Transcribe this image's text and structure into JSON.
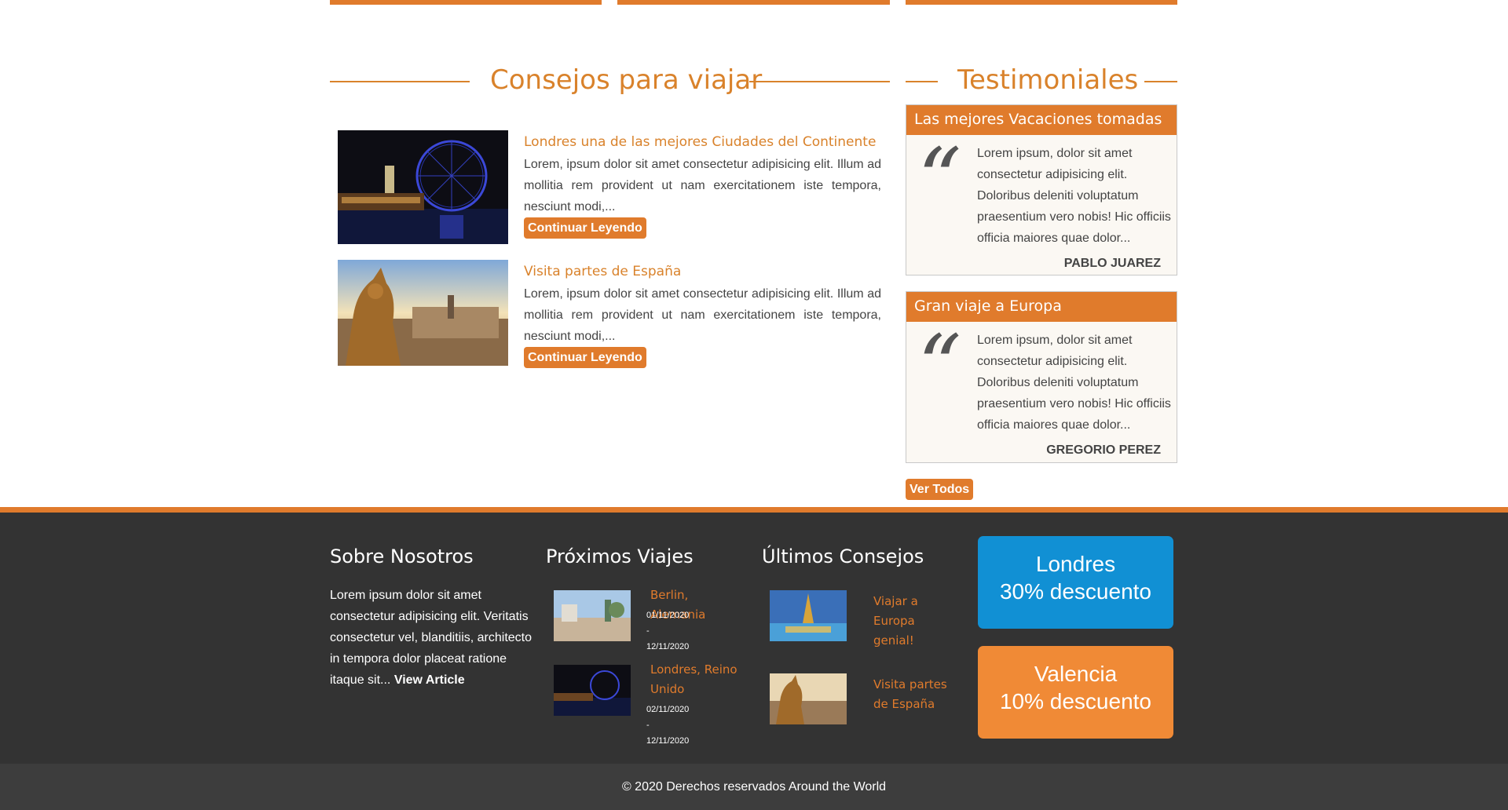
{
  "colors": {
    "accent": "#e07b2c",
    "title": "#d9822b",
    "footer_bg": "#333333",
    "promo_blue": "#1190d4",
    "promo_orange": "#f08a36"
  },
  "sections": {
    "tips_title": "Consejos para viajar",
    "testimonials_title": "Testimoniales"
  },
  "articles": [
    {
      "title": "Londres una de las mejores Ciudades del Continente",
      "text": "Lorem, ipsum dolor sit amet consectetur adipisicing elit. Illum ad mollitia rem provident ut nam exercitationem iste tempora, nesciunt modi,...",
      "button": "Continuar Leyendo"
    },
    {
      "title": "Visita partes de España",
      "text": "Lorem, ipsum dolor sit amet consectetur adipisicing elit. Illum ad mollitia rem provident ut nam exercitationem iste tempora, nesciunt modi,...",
      "button": "Continuar Leyendo"
    }
  ],
  "testimonials": [
    {
      "heading": "Las mejores Vacaciones tomadas",
      "quote_mark": "“",
      "text": "Lorem ipsum, dolor sit amet consectetur adipisicing elit. Doloribus deleniti voluptatum praesentium vero nobis! Hic officiis officia maiores quae dolor...",
      "author": "PABLO JUAREZ"
    },
    {
      "heading": "Gran viaje a Europa",
      "quote_mark": "“",
      "text": "Lorem ipsum, dolor sit amet consectetur adipisicing elit. Doloribus deleniti voluptatum praesentium vero nobis! Hic officiis officia maiores quae dolor...",
      "author": "GREGORIO PEREZ"
    }
  ],
  "see_all": "Ver Todos",
  "footer": {
    "about_title": "Sobre Nosotros",
    "about_text": "Lorem ipsum dolor sit amet consectetur adipisicing elit. Veritatis consectetur vel, blanditiis, architecto in tempora dolor placeat ratione itaque sit...",
    "about_link": "View Article",
    "trips_title": "Próximos Viajes",
    "trips": [
      {
        "name": "Berlin, Alemania",
        "start": "01/11/2020",
        "sep": "-",
        "end": "12/11/2020"
      },
      {
        "name": "Londres, Reino Unido",
        "start": "02/11/2020",
        "sep": "-",
        "end": "12/11/2020"
      }
    ],
    "tips_title": "Últimos Consejos",
    "tips": [
      {
        "text": "Viajar a Europa genial!"
      },
      {
        "text": "Visita partes de España"
      }
    ],
    "promos": [
      {
        "city": "Londres",
        "discount": "30% descuento"
      },
      {
        "city": "Valencia",
        "discount": "10% descuento"
      }
    ],
    "copyright": "© 2020 Derechos reservados Around the World"
  }
}
